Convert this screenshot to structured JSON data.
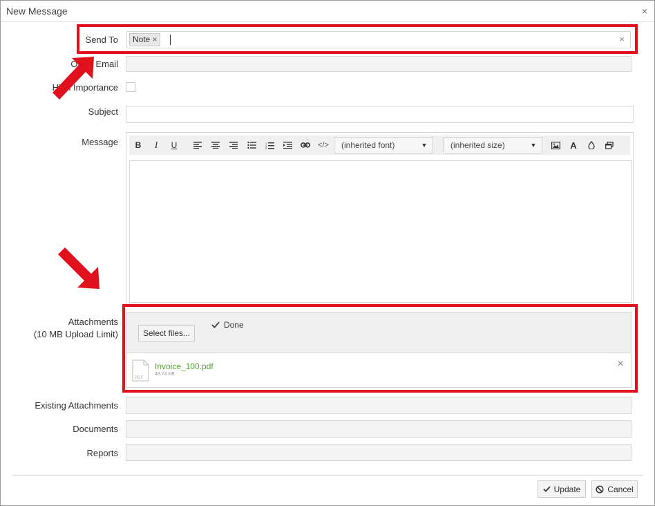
{
  "window": {
    "title": "New Message",
    "close_icon": "close-icon"
  },
  "form": {
    "send_to": {
      "label": "Send To",
      "tags": [
        {
          "label": "Note",
          "remove": "×"
        }
      ],
      "clear": "×"
    },
    "other_email": {
      "label": "Other Email",
      "value": ""
    },
    "high_importance": {
      "label": "High Importance",
      "checked": false
    },
    "subject": {
      "label": "Subject",
      "value": ""
    },
    "message": {
      "label": "Message",
      "toolbar": {
        "bold": "B",
        "italic": "I",
        "underline": "U",
        "font_select": "(inherited font)",
        "size_select": "(inherited size)",
        "text_color": "A"
      },
      "body": ""
    },
    "attachments": {
      "label_line1": "Attachments",
      "label_line2": "(10 MB Upload Limit)",
      "select_button": "Select files...",
      "status": "Done",
      "files": [
        {
          "name": "Invoice_100.pdf",
          "size": "48.74 KB",
          "type_label": "PDF"
        }
      ]
    },
    "existing_attachments": {
      "label": "Existing Attachments"
    },
    "documents": {
      "label": "Documents"
    },
    "reports": {
      "label": "Reports"
    }
  },
  "footer": {
    "update_label": "Update",
    "cancel_label": "Cancel"
  },
  "colors": {
    "highlight": "#e0101d",
    "arrow": "#e0101d",
    "file_name": "#5aa43a"
  }
}
